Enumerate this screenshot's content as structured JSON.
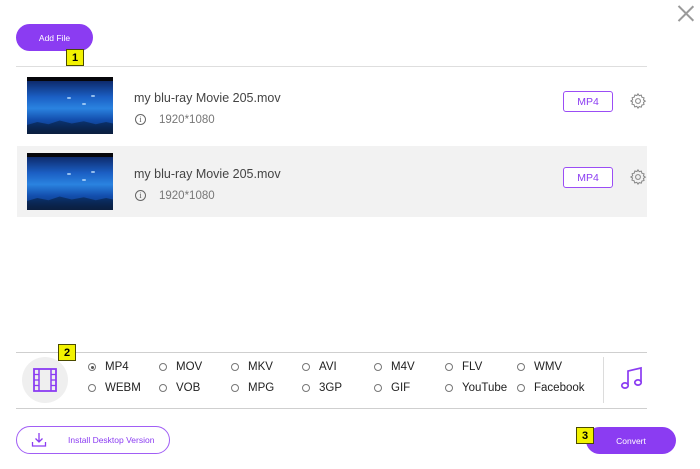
{
  "toolbar": {
    "add_file_label": "Add File",
    "close_icon": "close-icon"
  },
  "badges": [
    "1",
    "2",
    "3"
  ],
  "files": [
    {
      "name": "my blu-ray Movie 205.mov",
      "resolution": "1920*1080",
      "format": "MP4",
      "info_icon_glyph": "i"
    },
    {
      "name": "my blu-ray Movie 205.mov",
      "resolution": "1920*1080",
      "format": "MP4",
      "info_icon_glyph": "i"
    }
  ],
  "formats": {
    "selected": "MP4",
    "row1": [
      "MP4",
      "MOV",
      "MKV",
      "AVI",
      "M4V",
      "FLV",
      "WMV"
    ],
    "row2": [
      "WEBM",
      "VOB",
      "MPG",
      "3GP",
      "GIF",
      "YouTube",
      "Facebook"
    ]
  },
  "footer": {
    "install_label": "Install Desktop Version",
    "convert_label": "Convert"
  },
  "colors": {
    "accent": "#8b3cf2",
    "badge": "#f2f200"
  }
}
